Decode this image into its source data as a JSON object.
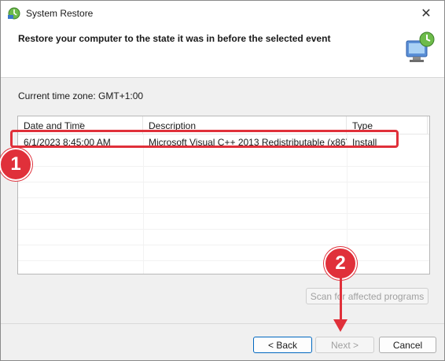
{
  "window": {
    "title": "System Restore",
    "close_glyph": "✕"
  },
  "header": {
    "heading": "Restore your computer to the state it was in before the selected event"
  },
  "timezone_label": "Current time zone: GMT+1:00",
  "table": {
    "columns": [
      "Date and Time",
      "Description",
      "Type"
    ],
    "rows": [
      {
        "date": "6/1/2023 8:45:00 AM",
        "description": "Microsoft Visual C++ 2013 Redistributable (x86) ...",
        "type": "Install"
      }
    ]
  },
  "buttons": {
    "scan": "Scan for affected programs",
    "back": "< Back",
    "next": "Next >",
    "cancel": "Cancel"
  },
  "annotations": {
    "badge1": "1",
    "badge2": "2"
  },
  "colors": {
    "annotation": "#e0303a",
    "accent": "#0067c0"
  },
  "icons": [
    "system-restore-icon",
    "close-icon",
    "restore-computer-icon",
    "sort-arrow-icon"
  ]
}
